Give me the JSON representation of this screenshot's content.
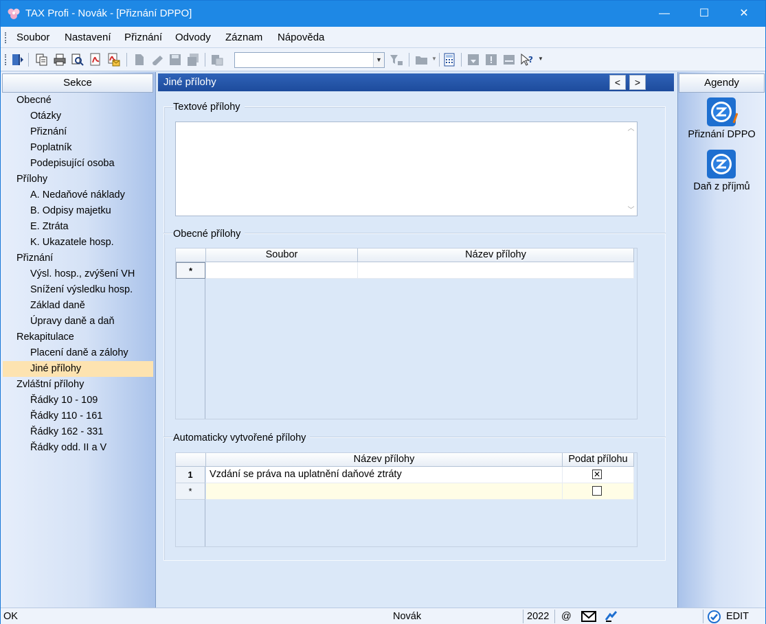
{
  "window": {
    "title": "TAX Profi - Novák - [Přiznání DPPO]",
    "min_glyph": "—",
    "max_glyph": "☐",
    "close_glyph": "✕"
  },
  "menu": [
    {
      "label": "Soubor"
    },
    {
      "label": "Nastavení"
    },
    {
      "label": "Přiznání"
    },
    {
      "label": "Odvody"
    },
    {
      "label": "Záznam"
    },
    {
      "label": "Nápověda"
    }
  ],
  "toolbar": {
    "combo_value": "",
    "icons": [
      "exit-icon",
      "copy-icon",
      "print-icon",
      "preview-icon",
      "pdf-icon",
      "pdf-mail-icon",
      "new-doc-icon",
      "edit-icon",
      "save-icon",
      "save-all-icon",
      "paste-icon",
      "filter-icon",
      "folder-icon",
      "calculator-icon",
      "down-icon",
      "info-icon",
      "card-icon",
      "help-icon"
    ]
  },
  "left_panel": {
    "header": "Sekce",
    "items": [
      {
        "label": "Obecné",
        "level": 0
      },
      {
        "label": "Otázky",
        "level": 1
      },
      {
        "label": "Přiznání",
        "level": 1
      },
      {
        "label": "Poplatník",
        "level": 1
      },
      {
        "label": "Podepisující osoba",
        "level": 1
      },
      {
        "label": "Přílohy",
        "level": 0
      },
      {
        "label": "A. Nedaňové náklady",
        "level": 1
      },
      {
        "label": "B. Odpisy majetku",
        "level": 1
      },
      {
        "label": "E. Ztráta",
        "level": 1
      },
      {
        "label": "K. Ukazatele hosp.",
        "level": 1
      },
      {
        "label": "Přiznání",
        "level": 0
      },
      {
        "label": "Výsl. hosp., zvýšení VH",
        "level": 1
      },
      {
        "label": "Snížení výsledku hosp.",
        "level": 1
      },
      {
        "label": "Základ daně",
        "level": 1
      },
      {
        "label": "Úpravy daně a daň",
        "level": 1
      },
      {
        "label": "Rekapitulace",
        "level": 0
      },
      {
        "label": "Placení daně a zálohy",
        "level": 1
      },
      {
        "label": "Jiné přílohy",
        "level": 1,
        "selected": true
      },
      {
        "label": "Zvláštní přílohy",
        "level": 0
      },
      {
        "label": "Řádky 10 - 109",
        "level": 1
      },
      {
        "label": "Řádky 110 - 161",
        "level": 1
      },
      {
        "label": "Řádky 162 - 331",
        "level": 1
      },
      {
        "label": "Řádky odd. II a V",
        "level": 1
      }
    ]
  },
  "main": {
    "header": "Jiné přílohy",
    "prev_glyph": "<",
    "next_glyph": ">",
    "text_group": {
      "title": "Textové přílohy",
      "value": ""
    },
    "general_group": {
      "title": "Obecné přílohy",
      "columns": [
        "Soubor",
        "Název přílohy"
      ],
      "new_row_marker": "*"
    },
    "auto_group": {
      "title": "Automaticky vytvořené přílohy",
      "columns": [
        "Název přílohy",
        "Podat přílohu"
      ],
      "rows": [
        {
          "num": "1",
          "name": "Vzdání se práva na uplatnění daňové ztráty",
          "checked": "✕"
        }
      ],
      "new_row_marker": "*"
    }
  },
  "right_panel": {
    "header": "Agendy",
    "items": [
      {
        "label": "Přiznání DPPO"
      },
      {
        "label": "Daň z příjmů"
      }
    ]
  },
  "status": {
    "left": "OK",
    "user": "Novák",
    "year": "2022",
    "at": "@",
    "mode": "EDIT"
  }
}
